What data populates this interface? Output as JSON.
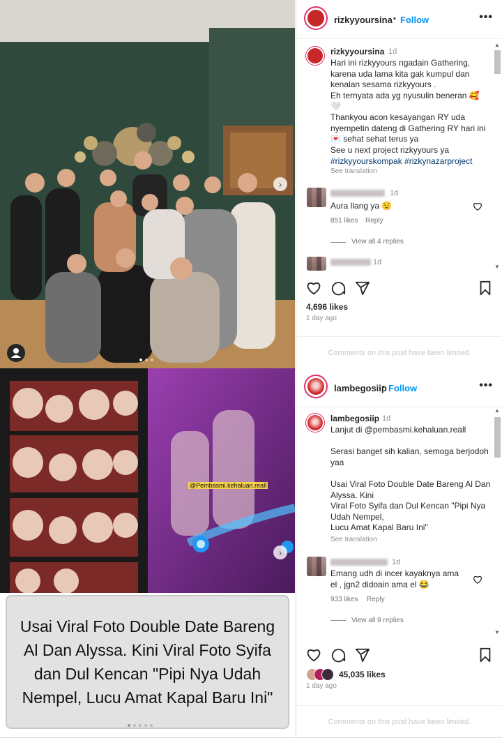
{
  "post1": {
    "username": "rizkyyoursina",
    "follow_label": "Follow",
    "more_label": "•••",
    "caption": {
      "username": "rizkyyoursina",
      "time": "1d",
      "text": "Hari ini rizkyyours ngadain Gathering, karena uda lama kita gak kumpul dan kenalan sesama rizkyyours .\nEh ternyata ada yg nyusulin beneran 🥰\n🤍\nThankyou acon kesayangan RY uda nyempetin dateng di Gathering RY hari ini 💌 sehat sehat terus ya\nSee u next project rizkyyours ya",
      "hashtags": "#rizkyyourskompak #rizkynazarproject",
      "see_translation": "See translation"
    },
    "comment": {
      "time": "1d",
      "text": "Aura llang ya 😟",
      "likes": "851 likes",
      "reply": "Reply",
      "view_replies": "View all 4 replies"
    },
    "comment2_time": "1d",
    "likes": "4,696 likes",
    "time": "1 day ago",
    "limited": "Comments on this post have been limited."
  },
  "post2": {
    "username": "lambegosiip",
    "follow_label": "Follow",
    "more_label": "•••",
    "caption": {
      "username": "lambegosiip",
      "time": "1d",
      "text": "Lanjut di @pembasmi.kehaluan.reall\n\nSerasi banget sih kalian, semoga berjodoh yaa\n\nUsai Viral Foto Double Date Bareng Al Dan Alyssa. Kini\nViral Foto Syifa dan Dul Kencan \"Pipi Nya Udah Nempel,\nLucu Amat Kapal Baru Ini\"",
      "see_translation": "See translation"
    },
    "comment": {
      "time": "1d",
      "text": "Emang udh di incer kayaknya ama el , jgn2 didoain ama el 😂",
      "likes": "933 likes",
      "reply": "Reply",
      "view_replies": "View all 9 replies"
    },
    "likes": "45,035 likes",
    "time": "1 day ago",
    "limited": "Comments on this post have been limited.",
    "image_watermark": "@Pembasmi.kehaluan.reall",
    "image_caption": "Usai Viral Foto Double Date Bareng Al Dan Alyssa. Kini Viral Foto Syifa dan Dul Kencan \"Pipi Nya Udah Nempel, Lucu Amat Kapal Baru Ini\""
  },
  "icons": [
    "heart-icon",
    "comment-icon",
    "share-icon",
    "bookmark-icon",
    "user-tag-icon",
    "next-arrow-icon"
  ],
  "colors": {
    "follow": "#0095f6",
    "link": "#00376b",
    "muted": "#8e8e8e"
  }
}
